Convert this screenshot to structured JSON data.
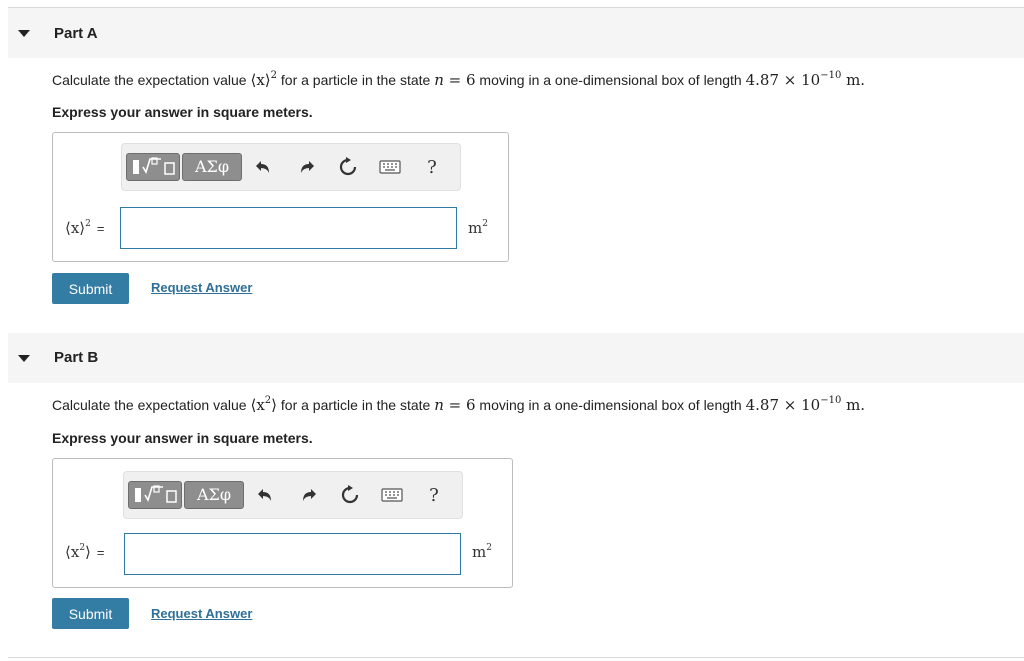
{
  "parts": [
    {
      "title": "Part A",
      "question_pre": "Calculate the expectation value ",
      "expr": "⟨x⟩",
      "expr_sup": "2",
      "question_mid": " for a particle in the state ",
      "state_var": "n",
      "state_eq": " = 6",
      "question_post": " moving in a one-dimensional box of length ",
      "length_value": "4.87 × 10",
      "length_exp": "−10",
      "length_unit": " m.",
      "instruction": "Express your answer in square meters.",
      "answer_label": "⟨x⟩",
      "answer_label_sup": "2",
      "equals": "=",
      "input_value": "",
      "unit": "m",
      "unit_sup": "2",
      "greek_label": "ΑΣφ",
      "help_label": "?",
      "submit_label": "Submit",
      "request_label": "Request Answer"
    },
    {
      "title": "Part B",
      "question_pre": "Calculate the expectation value ",
      "expr": "⟨x",
      "expr_sup": "2",
      "expr_close": "⟩",
      "question_mid": " for a particle in the state ",
      "state_var": "n",
      "state_eq": " = 6",
      "question_post": " moving in a one-dimensional box of length ",
      "length_value": "4.87 × 10",
      "length_exp": "−10",
      "length_unit": " m.",
      "instruction": "Express your answer in square meters.",
      "answer_label": "⟨x",
      "answer_label_sup": "2",
      "answer_label_close": "⟩",
      "equals": "=",
      "input_value": "",
      "unit": "m",
      "unit_sup": "2",
      "greek_label": "ΑΣφ",
      "help_label": "?",
      "submit_label": "Submit",
      "request_label": "Request Answer"
    }
  ]
}
